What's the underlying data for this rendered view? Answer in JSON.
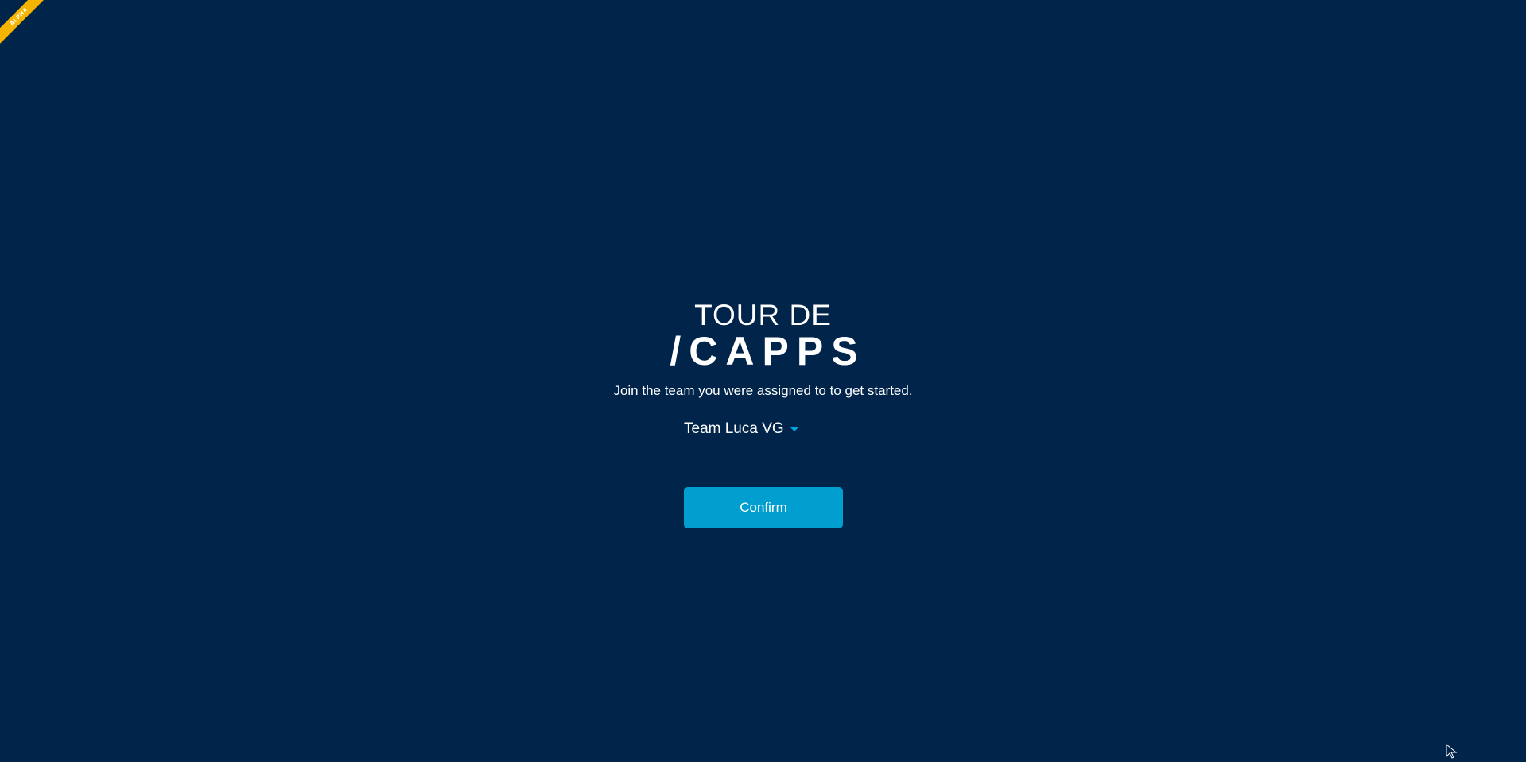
{
  "ribbon": {
    "label": "ALPHA",
    "color": "#f5b400"
  },
  "logo": {
    "line1": "TOUR DE",
    "line2": "/CAPPS"
  },
  "subtitle": "Join the team you were assigned to to get started.",
  "team_select": {
    "value": "Team Luca VG",
    "caret_icon": "chevron-down-icon",
    "accent": "#00a6e0"
  },
  "confirm": {
    "label": "Confirm",
    "color": "#009fcf"
  },
  "colors": {
    "background": "#00244a",
    "text": "#ffffff"
  }
}
